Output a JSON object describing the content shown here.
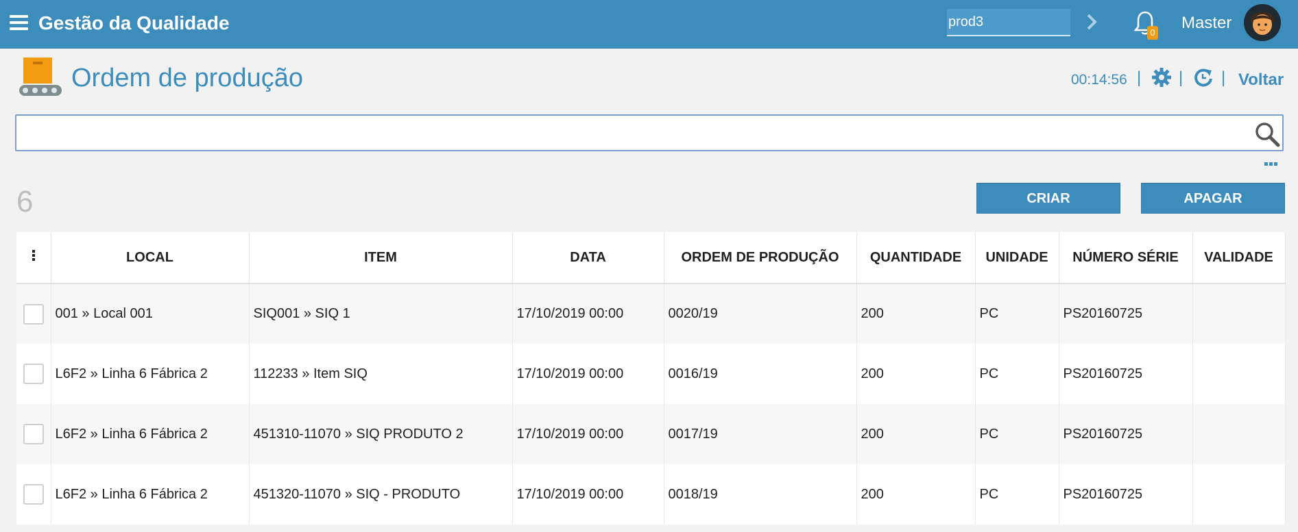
{
  "header": {
    "app_title": "Gestão da Qualidade",
    "search_value": "prod3",
    "notification_count": "0",
    "username": "Master",
    "brand_color": "#3c8dbc"
  },
  "page": {
    "title": "Ordem de produção",
    "timer": "00:14:56",
    "back_label": "Voltar",
    "search_placeholder": "",
    "record_count": "6"
  },
  "actions": {
    "create_label": "CRIAR",
    "delete_label": "APAGAR"
  },
  "table": {
    "columns": [
      "LOCAL",
      "ITEM",
      "DATA",
      "ORDEM DE PRODUÇÃO",
      "QUANTIDADE",
      "UNIDADE",
      "NÚMERO SÉRIE",
      "VALIDADE"
    ],
    "rows": [
      [
        "001 » Local 001",
        "SIQ001 » SIQ 1",
        "17/10/2019 00:00",
        "0020/19",
        "200",
        "PC",
        "PS20160725",
        ""
      ],
      [
        "L6F2 » Linha 6 Fábrica 2",
        "112233 » Item SIQ",
        "17/10/2019 00:00",
        "0016/19",
        "200",
        "PC",
        "PS20160725",
        ""
      ],
      [
        "L6F2 » Linha 6 Fábrica 2",
        "451310-11070 » SIQ PRODUTO 2",
        "17/10/2019 00:00",
        "0017/19",
        "200",
        "PC",
        "PS20160725",
        ""
      ],
      [
        "L6F2 » Linha 6 Fábrica 2",
        "451320-11070 » SIQ - PRODUTO",
        "17/10/2019 00:00",
        "0018/19",
        "200",
        "PC",
        "PS20160725",
        ""
      ]
    ]
  }
}
